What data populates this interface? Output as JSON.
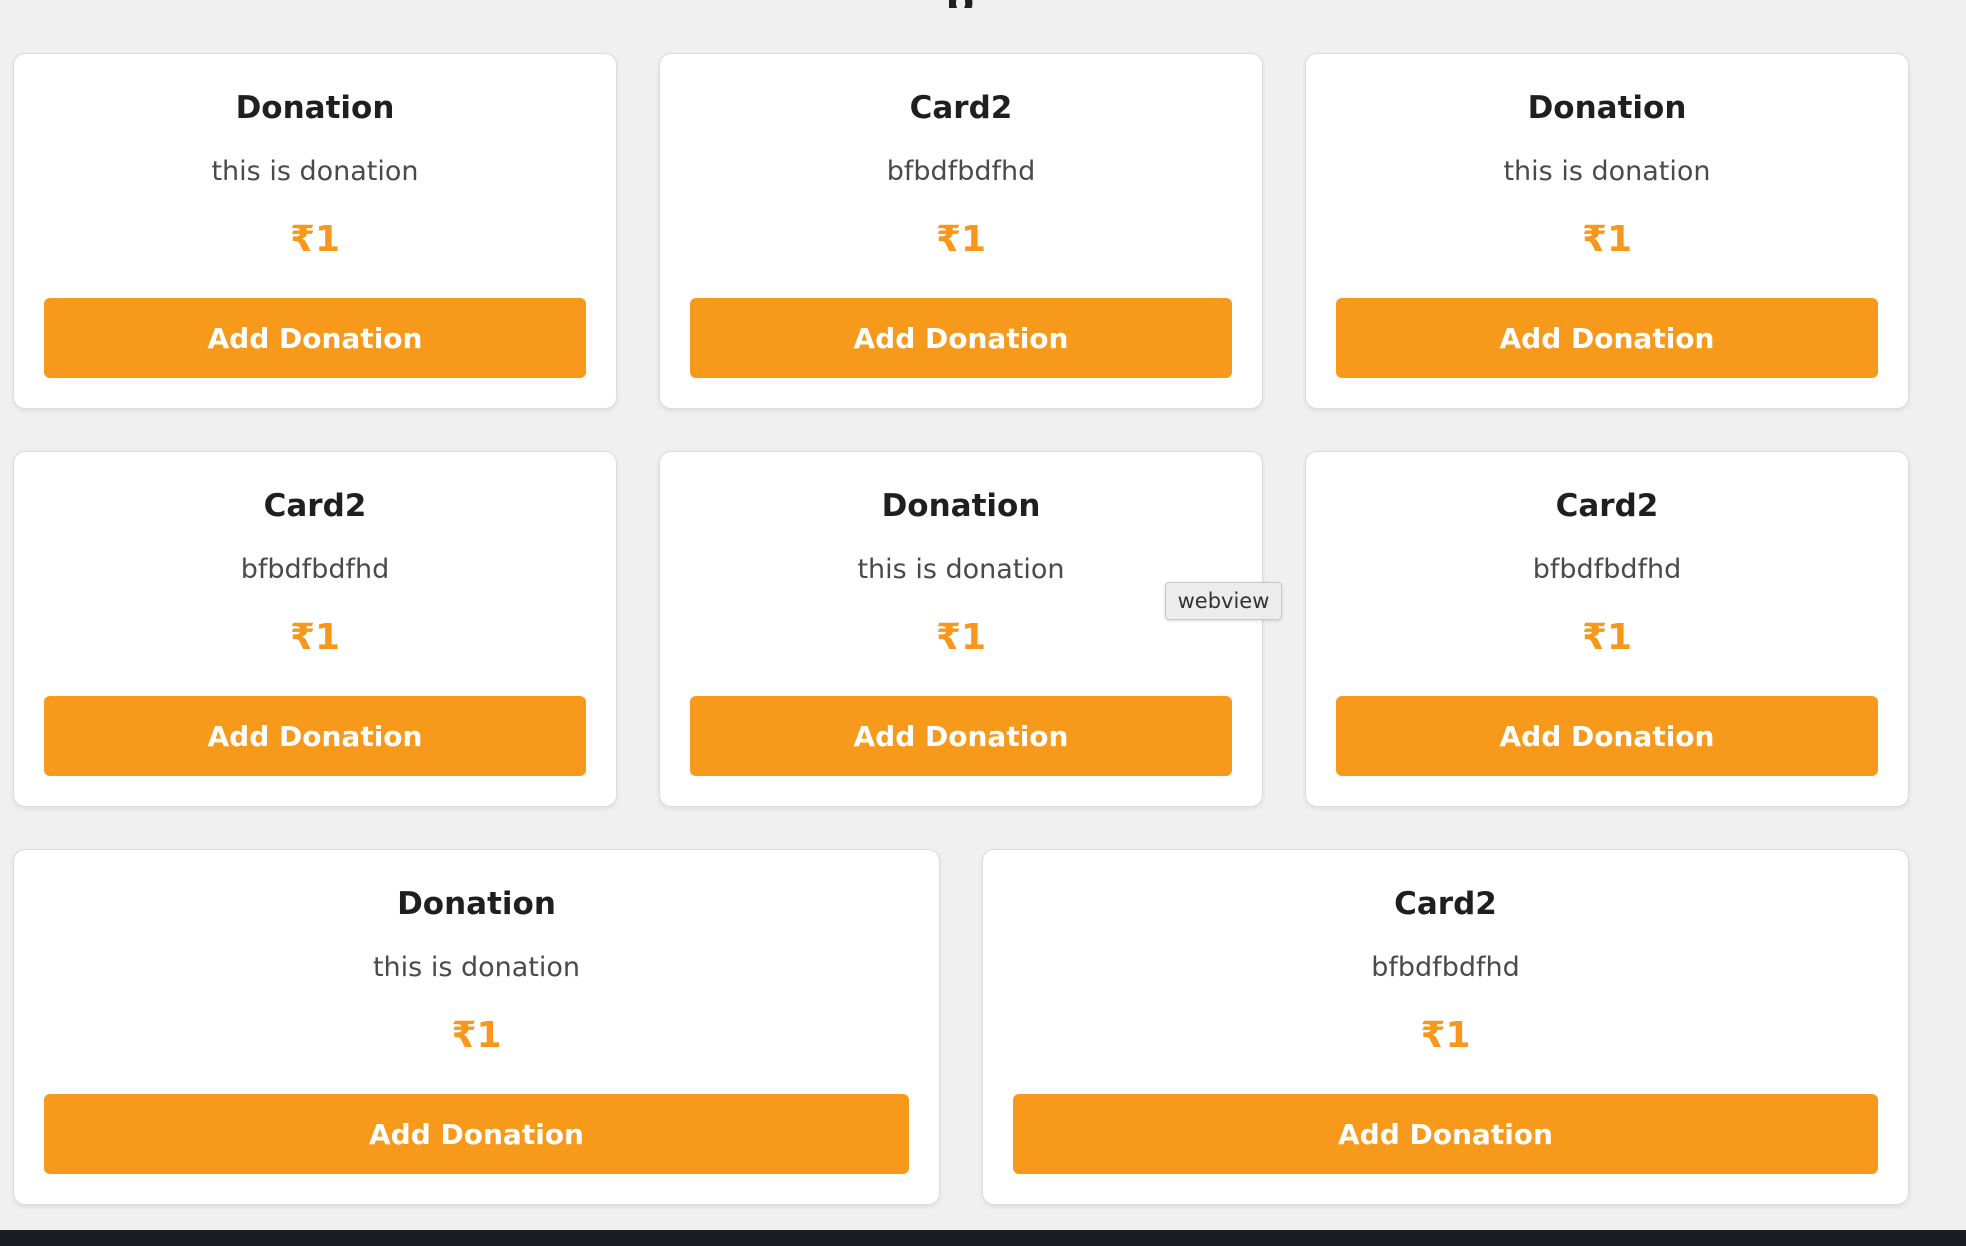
{
  "page": {
    "heading_peek": "p"
  },
  "cards": [
    {
      "title": "Donation",
      "description": "this is donation",
      "amount": "₹1",
      "button_label": "Add Donation"
    },
    {
      "title": "Card2",
      "description": "bfbdfbdfhd",
      "amount": "₹1",
      "button_label": "Add Donation"
    },
    {
      "title": "Donation",
      "description": "this is donation",
      "amount": "₹1",
      "button_label": "Add Donation"
    },
    {
      "title": "Card2",
      "description": "bfbdfbdfhd",
      "amount": "₹1",
      "button_label": "Add Donation"
    },
    {
      "title": "Donation",
      "description": "this is donation",
      "amount": "₹1",
      "button_label": "Add Donation"
    },
    {
      "title": "Card2",
      "description": "bfbdfbdfhd",
      "amount": "₹1",
      "button_label": "Add Donation"
    },
    {
      "title": "Donation",
      "description": "this is donation",
      "amount": "₹1",
      "button_label": "Add Donation"
    },
    {
      "title": "Card2",
      "description": "bfbdfbdfhd",
      "amount": "₹1",
      "button_label": "Add Donation"
    }
  ],
  "tooltip": {
    "text": "webview"
  },
  "colors": {
    "accent": "#f7991b",
    "page_background": "#f1f0f1",
    "card_background": "#ffffff",
    "frame": "#1c1d22"
  }
}
